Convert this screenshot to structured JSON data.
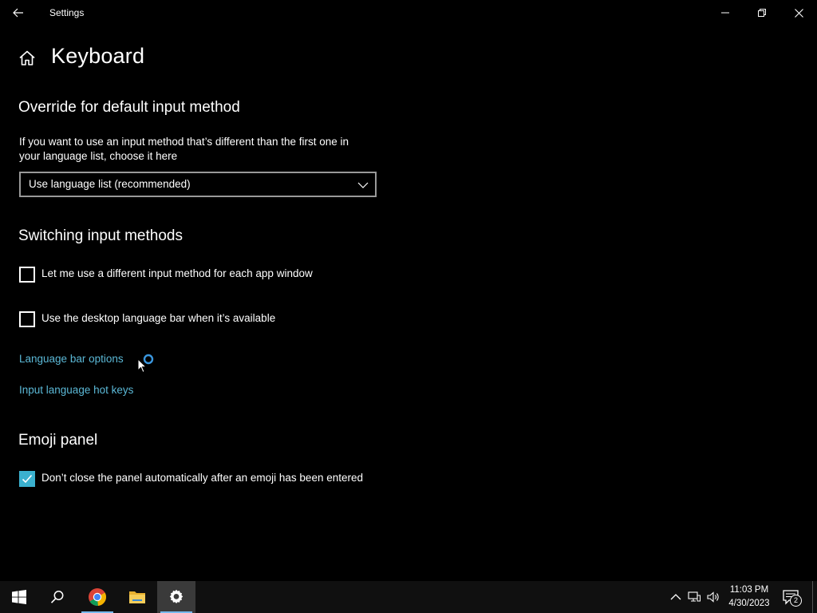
{
  "window": {
    "title": "Settings"
  },
  "page": {
    "title": "Keyboard"
  },
  "override": {
    "heading": "Override for default input method",
    "description_line1": "If you want to use an input method that’s different than the first one in",
    "description_line2": "your language list, choose it here",
    "dropdown_value": "Use language list (recommended)"
  },
  "switching": {
    "heading": "Switching input methods",
    "checkbox1_label": "Let me use a different input method for each app window",
    "checkbox1_checked": false,
    "checkbox2_label": "Use the desktop language bar when it’s available",
    "checkbox2_checked": false,
    "link1": "Language bar options",
    "link2": "Input language hot keys"
  },
  "emoji": {
    "heading": "Emoji panel",
    "checkbox_label": "Don’t close the panel automatically after an emoji has been entered",
    "checkbox_checked": true
  },
  "taskbar": {
    "time": "11:03 PM",
    "date": "4/30/2023",
    "notification_count": "2",
    "apps": [
      "start-icon",
      "search-icon",
      "chrome-icon",
      "file-explorer-icon",
      "settings-icon"
    ]
  },
  "colors": {
    "accent": "#3bb1cf",
    "link": "#5bb8d6",
    "background": "#000000",
    "taskbar": "#101010"
  }
}
